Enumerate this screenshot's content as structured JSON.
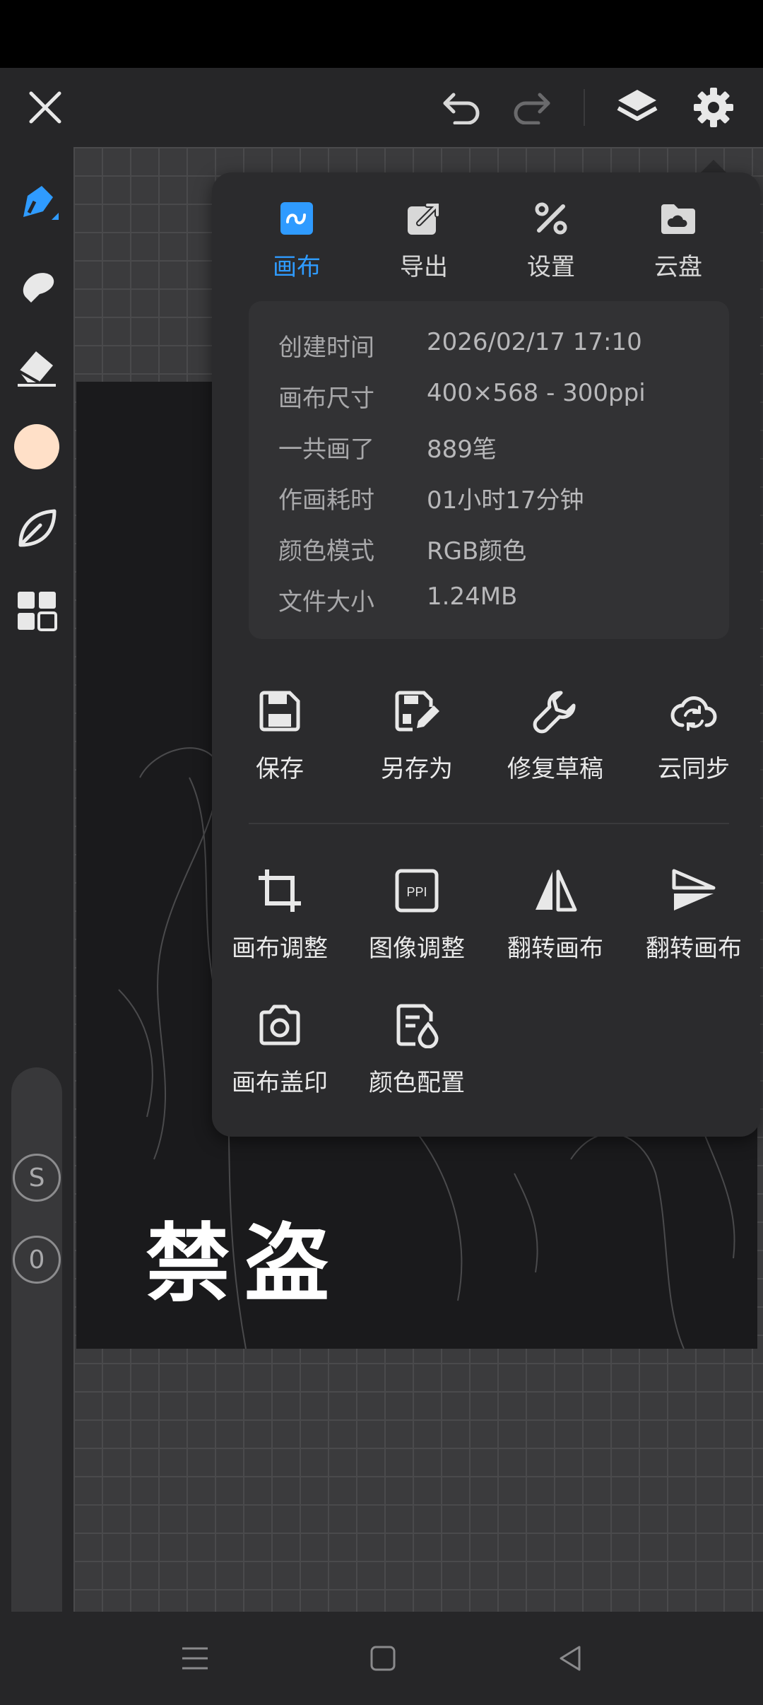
{
  "top_bar": {
    "close_icon": "close-icon",
    "undo_icon": "undo-icon",
    "redo_icon": "redo-icon",
    "layers_icon": "layers-icon",
    "settings_icon": "gear-icon"
  },
  "left_toolbar": {
    "tools": [
      "pen-icon",
      "smudge-icon",
      "eraser-icon",
      "color-swatch",
      "leaf-icon",
      "grid-icon"
    ],
    "swatch_color": "#ffe0c8",
    "badge_s": "S",
    "badge_0": "0"
  },
  "canvas": {
    "watermark": "禁盗"
  },
  "panel": {
    "tabs": [
      {
        "label": "画布",
        "icon": "canvas-icon",
        "active": true
      },
      {
        "label": "导出",
        "icon": "export-icon",
        "active": false
      },
      {
        "label": "设置",
        "icon": "settings-tools-icon",
        "active": false
      },
      {
        "label": "云盘",
        "icon": "cloud-folder-icon",
        "active": false
      }
    ],
    "info": [
      {
        "key": "创建时间",
        "value": "2026/02/17 17:10"
      },
      {
        "key": "画布尺寸",
        "value": "400×568 - 300ppi"
      },
      {
        "key": "一共画了",
        "value": "889笔"
      },
      {
        "key": "作画耗时",
        "value": "01小时17分钟"
      },
      {
        "key": "颜色模式",
        "value": "RGB颜色"
      },
      {
        "key": "文件大小",
        "value": "1.24MB"
      }
    ],
    "actions_row1": [
      {
        "label": "保存",
        "icon": "save-icon"
      },
      {
        "label": "另存为",
        "icon": "save-as-icon"
      },
      {
        "label": "修复草稿",
        "icon": "wrench-icon"
      },
      {
        "label": "云同步",
        "icon": "cloud-sync-icon"
      }
    ],
    "actions_row2": [
      {
        "label": "画布调整",
        "icon": "crop-icon"
      },
      {
        "label": "图像调整",
        "icon": "ppi-icon",
        "icon_text": "PPI"
      },
      {
        "label": "翻转画布",
        "icon": "flip-horizontal-icon"
      },
      {
        "label": "翻转画布",
        "icon": "flip-vertical-icon"
      }
    ],
    "actions_row3": [
      {
        "label": "画布盖印",
        "icon": "camera-icon"
      },
      {
        "label": "颜色配置",
        "icon": "color-config-icon"
      }
    ]
  },
  "colors": {
    "accent": "#2f9bff",
    "panel_bg": "#2b2b2d"
  },
  "nav": {
    "menu_icon": "menu-icon",
    "home_icon": "home-icon",
    "back_icon": "back-icon"
  }
}
